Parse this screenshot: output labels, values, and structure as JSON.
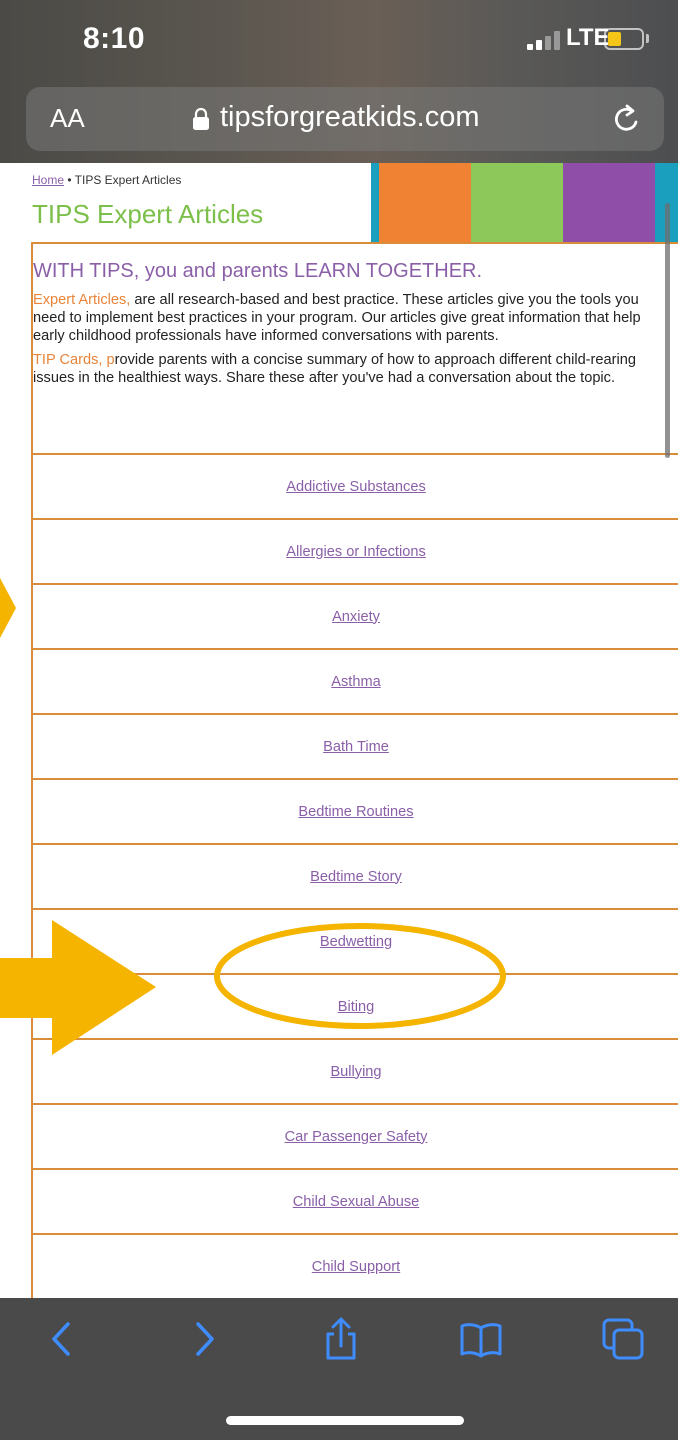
{
  "status_bar": {
    "time": "8:10",
    "network": "LTE",
    "battery_level": 0.4,
    "battery_color": "#f5c518"
  },
  "address_bar": {
    "text_size_label": "AA",
    "url": "tipsforgreatkids.com",
    "lock_icon": "lock-icon",
    "reload_icon": "reload-icon"
  },
  "page": {
    "breadcrumb": {
      "home": "Home",
      "separator": " • ",
      "current": "TIPS Expert Articles"
    },
    "title": "TIPS Expert Articles",
    "intro": {
      "heading": "WITH TIPS, you and parents LEARN TOGETHER.",
      "p1_highlight": "Expert Articles,",
      "p1_text": " are all research-based and best practice.  These articles give you the tools you need to implement best practices in your program.  Our articles give great information that help early childhood professionals have informed conversations with parents.",
      "p2_highlight": "TIP Cards, p",
      "p2_text": "rovide parents with a concise summary of how to approach different child-rearing issues in the healthiest ways.  Share these after you've had a conversation about the topic."
    },
    "articles": [
      "Addictive Substances",
      "Allergies or Infections",
      "Anxiety",
      "Asthma",
      "Bath Time",
      "Bedtime Routines",
      "Bedtime Story",
      "Bedwetting",
      "Biting",
      "Bullying",
      "Car Passenger Safety",
      "Child Sexual Abuse",
      "Child Support"
    ]
  },
  "toolbar": {
    "back_icon": "back-arrow-icon",
    "forward_icon": "forward-arrow-icon",
    "share_icon": "share-icon",
    "bookmarks_icon": "bookmarks-icon",
    "tabs_icon": "tabs-icon"
  },
  "colors": {
    "accent_orange": "#d98d3a",
    "link_purple": "#8a5fa8",
    "title_green": "#7cc04b",
    "annotation_yellow": "#f5b400",
    "ios_blue": "#3f8cff"
  }
}
